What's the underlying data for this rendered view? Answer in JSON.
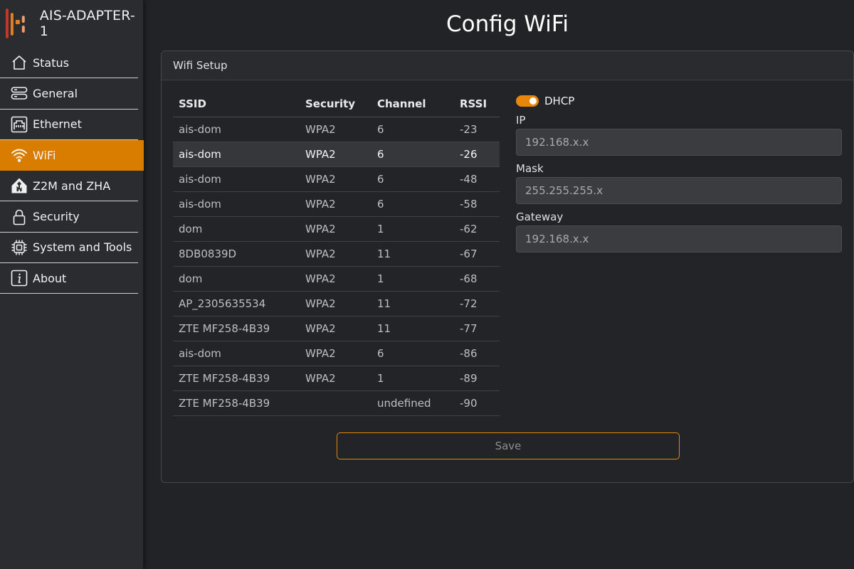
{
  "brand": {
    "name": "AIS-ADAPTER-1",
    "logo_icon": "ais-logo-icon"
  },
  "sidebar": {
    "items": [
      {
        "label": "Status",
        "icon": "home-icon",
        "active": false
      },
      {
        "label": "General",
        "icon": "server-icon",
        "active": false
      },
      {
        "label": "Ethernet",
        "icon": "ethernet-icon",
        "active": false
      },
      {
        "label": "WiFi",
        "icon": "wifi-icon",
        "active": true
      },
      {
        "label": "Z2M and ZHA",
        "icon": "home-assistant-icon",
        "active": false
      },
      {
        "label": "Security",
        "icon": "lock-icon",
        "active": false
      },
      {
        "label": "System and Tools",
        "icon": "cpu-icon",
        "active": false
      },
      {
        "label": "About",
        "icon": "info-icon",
        "active": false
      }
    ]
  },
  "page": {
    "title": "Config WiFi"
  },
  "card": {
    "title": "Wifi Setup"
  },
  "table": {
    "headers": [
      "SSID",
      "Security",
      "Channel",
      "RSSI"
    ],
    "rows": [
      [
        "ais-dom",
        "WPA2",
        "6",
        "-23"
      ],
      [
        "ais-dom",
        "WPA2",
        "6",
        "-26"
      ],
      [
        "ais-dom",
        "WPA2",
        "6",
        "-48"
      ],
      [
        "ais-dom",
        "WPA2",
        "6",
        "-58"
      ],
      [
        "dom",
        "WPA2",
        "1",
        "-62"
      ],
      [
        "8DB0839D",
        "WPA2",
        "11",
        "-67"
      ],
      [
        "dom",
        "WPA2",
        "1",
        "-68"
      ],
      [
        "AP_2305635534",
        "WPA2",
        "11",
        "-72"
      ],
      [
        "ZTE MF258-4B39",
        "WPA2",
        "11",
        "-77"
      ],
      [
        "ais-dom",
        "WPA2",
        "6",
        "-86"
      ],
      [
        "ZTE MF258-4B39",
        "WPA2",
        "1",
        "-89"
      ],
      [
        "ZTE MF258-4B39",
        "",
        "undefined",
        "-90"
      ]
    ],
    "highlighted_row": 1
  },
  "network": {
    "dhcp_label": "DHCP",
    "dhcp_enabled": true,
    "ip_label": "IP",
    "ip_placeholder": "192.168.x.x",
    "mask_label": "Mask",
    "mask_placeholder": "255.255.255.x",
    "gateway_label": "Gateway",
    "gateway_placeholder": "192.168.x.x"
  },
  "save_label": "Save",
  "colors": {
    "accent": "#d97d00",
    "toggle": "#e8860c",
    "background": "#222326",
    "sidebar": "#2b2c2f"
  }
}
